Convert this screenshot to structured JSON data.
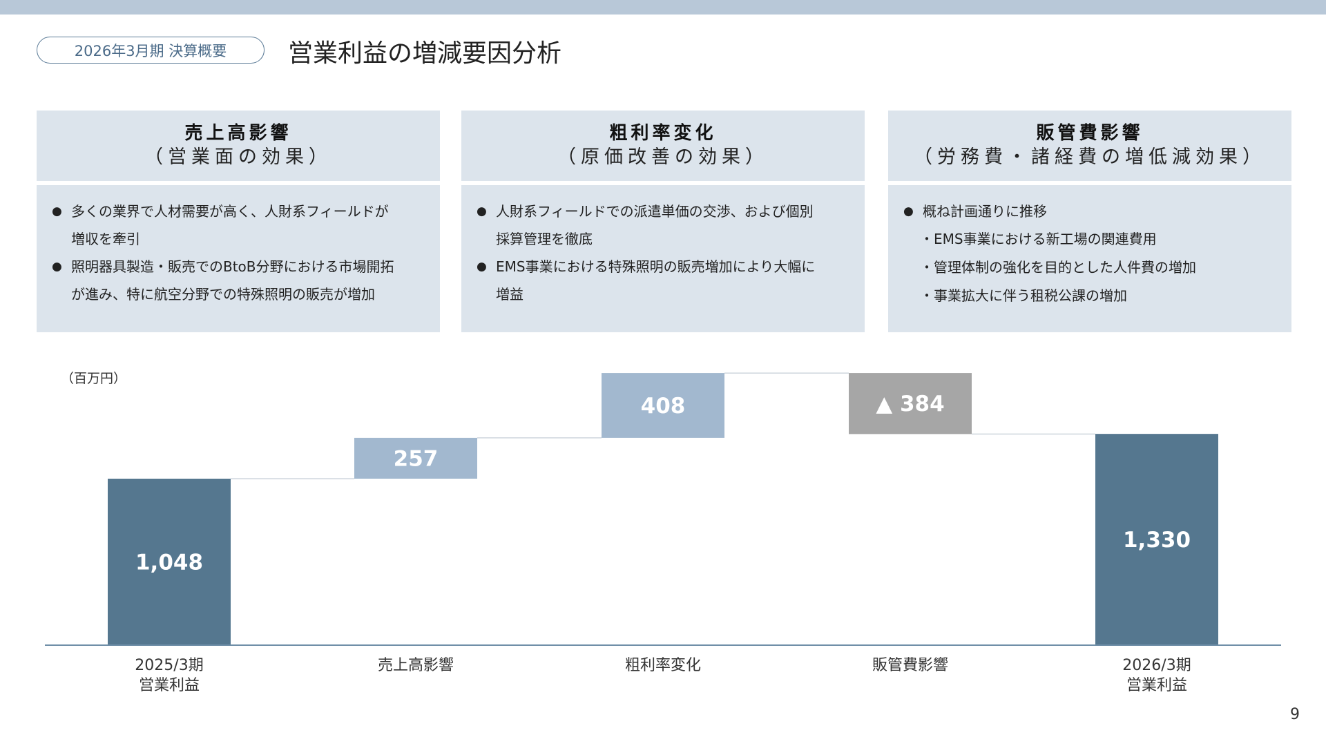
{
  "header": {
    "section_label": "2026年3月期 決算概要",
    "title": "営業利益の増減要因分析"
  },
  "cards": [
    {
      "title": "売上高影響",
      "subtitle": "（営業面の効果）",
      "bullets": [
        [
          "多くの業界で人材需要が高く、人財系フィールドが",
          "増収を牽引"
        ],
        [
          "照明器具製造・販売でのBtoB分野における市場開拓",
          "が進み、特に航空分野での特殊照明の販売が増加"
        ]
      ],
      "sub_items": []
    },
    {
      "title": "粗利率変化",
      "subtitle": "（原価改善の効果）",
      "bullets": [
        [
          "人財系フィールドでの派遣単価の交渉、および個別",
          "採算管理を徹底"
        ],
        [
          "EMS事業における特殊照明の販売増加により大幅に",
          "増益"
        ]
      ],
      "sub_items": []
    },
    {
      "title": "販管費影響",
      "subtitle": "（労務費・諸経費の増低減効果）",
      "bullets": [
        [
          "概ね計画通りに推移"
        ]
      ],
      "sub_items": [
        "・EMS事業における新工場の関連費用",
        "・管理体制の強化を目的とした人件費の増加",
        "・事業拡大に伴う租税公課の増加"
      ]
    }
  ],
  "chart_data": {
    "type": "bar",
    "subtype": "waterfall",
    "unit_label": "（百万円）",
    "categories": [
      "2025/3期\n営業利益",
      "売上高影響",
      "粗利率変化",
      "販管費影響",
      "2026/3期\n営業利益"
    ],
    "values": [
      1048,
      257,
      408,
      -384,
      1330
    ],
    "kinds": [
      "total",
      "increase",
      "increase",
      "decrease",
      "total"
    ],
    "data_labels": [
      "1,048",
      "257",
      "408",
      "▲ 384",
      "1,330"
    ],
    "colors": {
      "total": "#55778f",
      "increase": "#a2b8cf",
      "decrease": "#a6a6a6"
    },
    "ylim": [
      0,
      1713
    ],
    "grid": false,
    "legend": "none"
  },
  "footer": {
    "page_number": "9"
  }
}
